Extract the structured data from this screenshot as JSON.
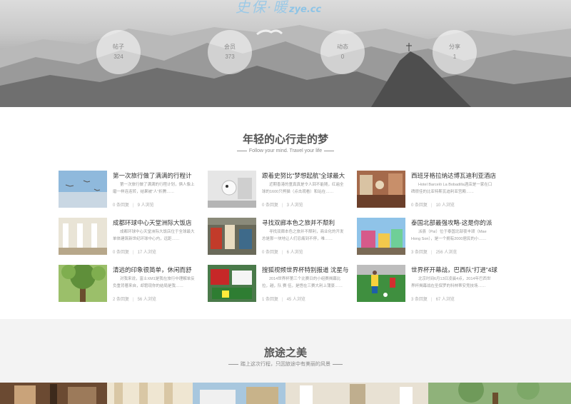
{
  "hero": {
    "logo_script": "史保·暖",
    "logo_url": "zye.cc",
    "stats": [
      {
        "label": "帖子",
        "value": "324"
      },
      {
        "label": "会员",
        "value": "373"
      },
      {
        "label": "动态",
        "value": "0"
      },
      {
        "label": "分享",
        "value": "1"
      }
    ]
  },
  "section1": {
    "title": "年轻的心行走的梦",
    "subtitle": "Follow your mind. Travel your life",
    "cards": [
      {
        "title": "第一次旅行做了满满的行程计",
        "desc": "第一次旅行做了满满的行程计划，俩人像上磨一样连连转，结果被“人”折腾……",
        "replies": "0 条回复",
        "views": "9 人浏览"
      },
      {
        "title": "跟着史努比“梦想起航”全球最大",
        "desc": "近期香港的童真真是令人回不能随，红遍全球的1600只熊猫（点击观看）和站在……",
        "replies": "0 条回复",
        "views": "3 人浏览"
      },
      {
        "title": "西班牙格拉纳达博瓦迪利亚酒店",
        "desc": "Hotel Barceló La Bobadilla酒店是一家在口碑很佳的比亚特斯瓦迪利亚宫殿……",
        "replies": "0 条回复",
        "views": "10 人浏览"
      },
      {
        "title": "成都环球中心天堂洲际大饭店",
        "desc": "成都环球中心天堂洲际大饭店位于全球最大单体建筑新世纪环球中心内，远距……",
        "replies": "0 条回复",
        "views": "17 人浏览"
      },
      {
        "title": "寻找双廊本色之旅并不颓利",
        "desc": "寻找双廊本色之旅并不颓利，商业化的开发总是那一块地让人们忍痛到不停，唯……",
        "replies": "0 条回复",
        "views": "6 人浏览"
      },
      {
        "title": "泰国北部最强攻略-这是你的派",
        "desc": "派县（Pai）位于泰国北部夜丰颂（Mae Hong Son），是一个拥有2000居民的小……",
        "replies": "3 条回复",
        "views": "256 人浏览"
      },
      {
        "title": "清远的印象很简单，休闲而舒",
        "desc": "对我来说，富士XM1是我在旅行中理解单反负重背著来自，却窘现你的结局是我……",
        "replies": "2 条回复",
        "views": "56 人浏览"
      },
      {
        "title": "搜狐视频世界杯特别报道 沈星与",
        "desc": "2014世界杯第三个比赛日的小组赛揭幕比拉，越，队 赛 伍，是悟在三赛大利上蒲豪……",
        "replies": "1 条回复",
        "views": "45 人浏览"
      },
      {
        "title": "世界杯开幕战，巴西队“打进”4球",
        "desc": "北京时间6月13日凌晨4点，2014年巴西世界杯揭幕战在圣保罗的科林蒂安竞技场……",
        "replies": "3 条回复",
        "views": "67 人浏览"
      }
    ]
  },
  "section2": {
    "title": "旅途之美",
    "subtitle": "踏上这次行程，只因旅途中有美丽的风景"
  }
}
